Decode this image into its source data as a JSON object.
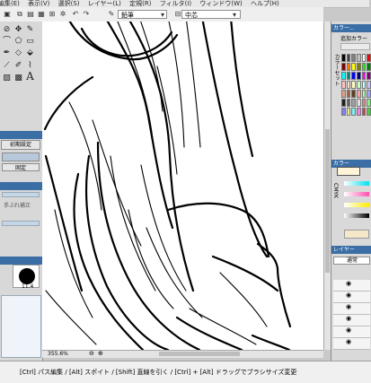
{
  "menu": [
    "編集(E)",
    "表示(V)",
    "選択(S)",
    "レイヤー(L)",
    "定規(R)",
    "フィルタ(I)",
    "ウィンドウ(W)",
    "ヘルプ(H)"
  ],
  "toolbar": {
    "brush_field": "鉛筆",
    "size_field": "中芯"
  },
  "left_panel": {
    "preset_label": "初期設定",
    "fix_label": "固定",
    "correction_label": "手ぶれ補正",
    "brush_size": "11.4"
  },
  "canvas": {
    "zoom": "355.6%"
  },
  "right_panel": {
    "color_header": "カラー...",
    "add_color_label": "追加カラー",
    "color_set_label": "カラーセット",
    "color_header2": "カラー",
    "layer_header": "レイヤー",
    "blend_mode": "通常"
  },
  "status": {
    "hint": "[Ctrl] パス編集 / [Alt] スポイト / [Shift] 直線を引く / [Ctrl] + [Alt] ドラッグでブラシサイズ変更"
  },
  "colors": {
    "swatches": [
      "#000000",
      "#404040",
      "#808080",
      "#c0c0c0",
      "#ffffff",
      "#ff0000",
      "#800000",
      "#ff8000",
      "#ffff00",
      "#808000",
      "#00ff00",
      "#008000",
      "#00ffff",
      "#008080",
      "#0000ff",
      "#000080",
      "#ff00ff",
      "#800080",
      "#ffc0c0",
      "#ffe0c0",
      "#ffffc0",
      "#c0ffc0",
      "#c0ffff",
      "#c0c0ff",
      "#e0a080",
      "#a06040",
      "#604020",
      "#ffa0a0",
      "#a0ffa0",
      "#a0a0ff",
      "#202020",
      "#606060",
      "#a0a0a0",
      "#e0e0e0",
      "#f08080",
      "#80f080",
      "#8080f0",
      "#f0f080",
      "#80f0f0",
      "#f080f0",
      "#d04040",
      "#40d040"
    ]
  }
}
